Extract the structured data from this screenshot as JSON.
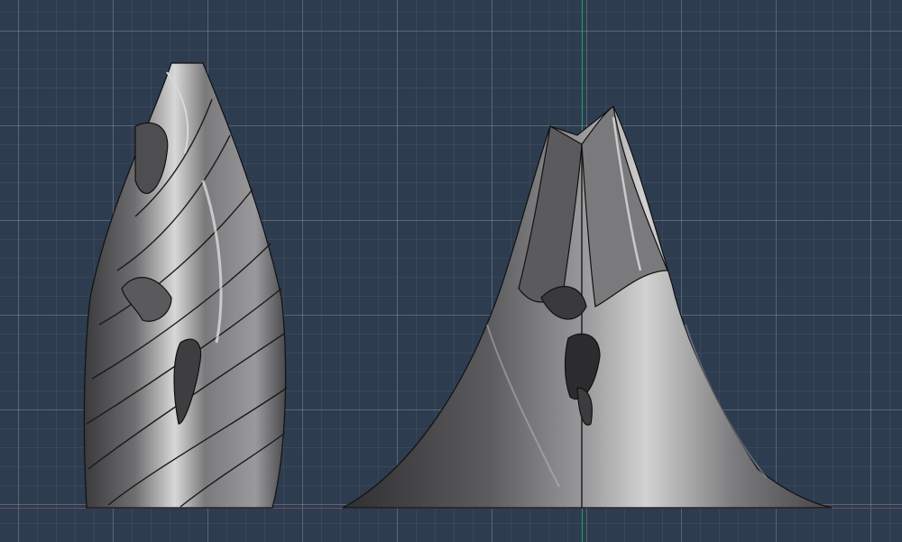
{
  "viewport": {
    "background_color": "#2e3c4f",
    "grid_color": "#8a97a8",
    "axis_y_color": "#1fa36a",
    "axis_x_color": "#7a4b5c",
    "models": [
      {
        "name": "twisted-spire",
        "icon": "twisted-spiral-mesh"
      },
      {
        "name": "flared-twist-mountain",
        "icon": "flared-spiral-mesh"
      }
    ]
  }
}
